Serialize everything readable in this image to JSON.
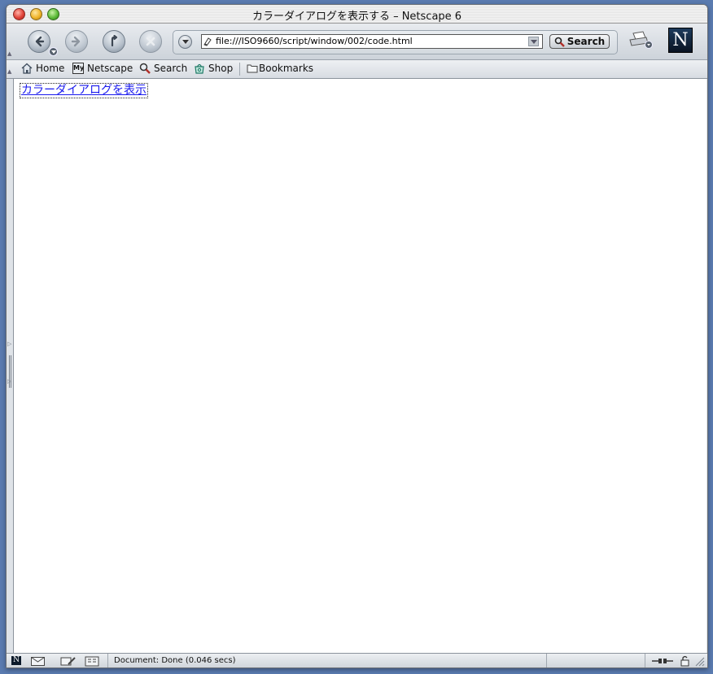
{
  "window": {
    "title": "カラーダイアログを表示する – Netscape 6"
  },
  "navigation": {
    "back_icon": "back-arrow-icon",
    "forward_icon": "forward-arrow-icon",
    "reload_icon": "reload-icon",
    "stop_icon": "stop-icon"
  },
  "urlbar": {
    "value": "file:///ISO9660/script/window/002/code.html",
    "search_label": "Search"
  },
  "personal_toolbar": {
    "home": "Home",
    "my_netscape_badge": "My",
    "netscape": "Netscape",
    "search": "Search",
    "shop": "Shop",
    "bookmarks": "Bookmarks"
  },
  "page": {
    "link_text": "カラーダイアログを表示"
  },
  "statusbar": {
    "text": "Document: Done (0.046 secs)"
  },
  "logo": {
    "letter": "N"
  },
  "colors": {
    "link": "#1a1aee",
    "desktop": "#5a7bb0"
  }
}
